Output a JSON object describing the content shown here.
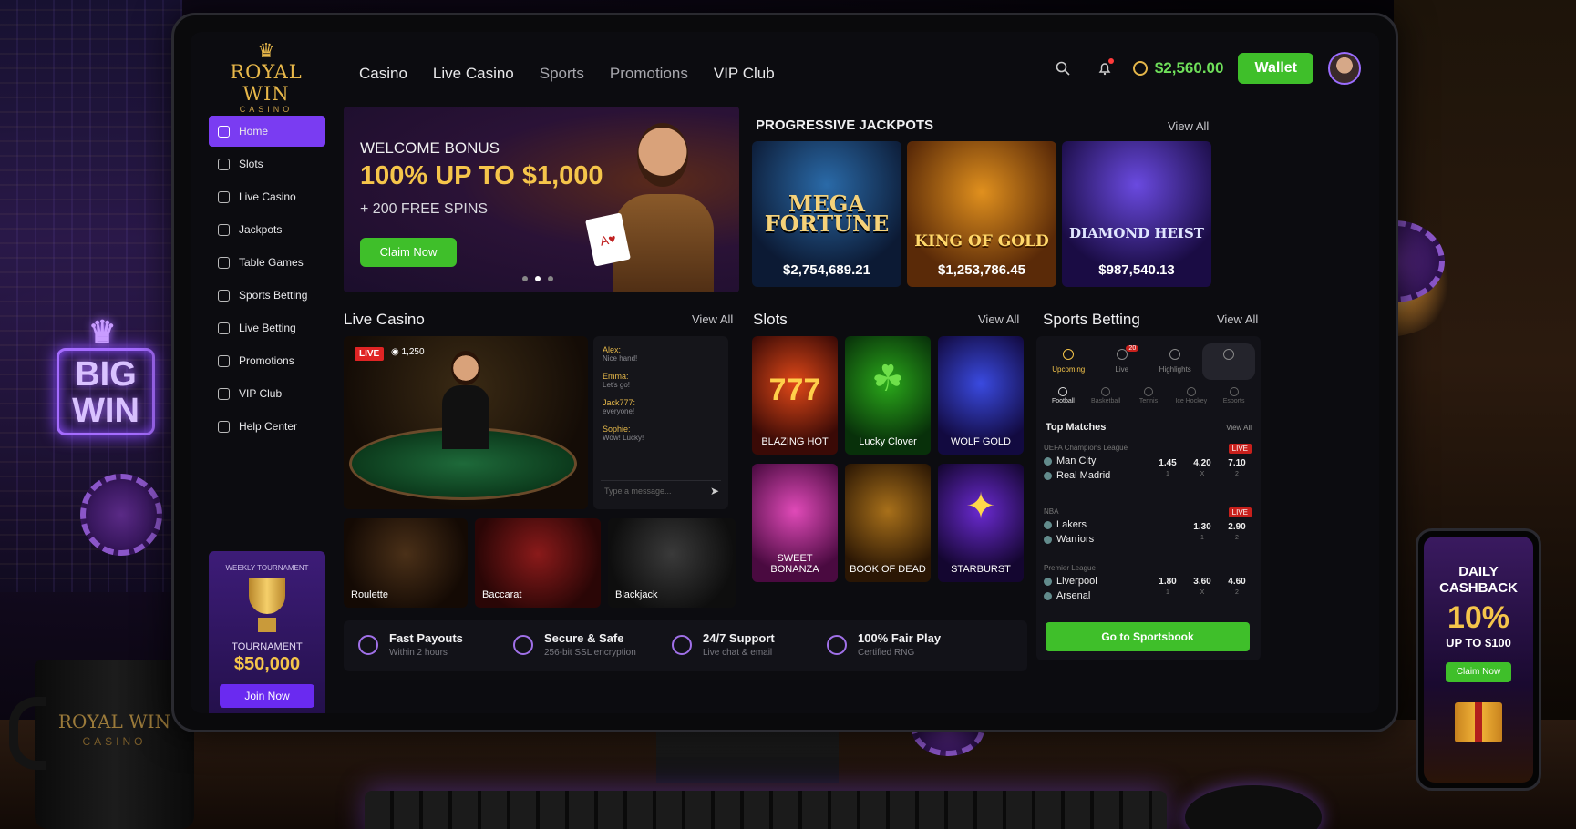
{
  "brand": {
    "name": "ROYAL WIN",
    "sub": "CASINO"
  },
  "nav": [
    "Casino",
    "Live Casino",
    "Sports",
    "Promotions",
    "VIP Club"
  ],
  "header": {
    "balance": "$2,560.00",
    "wallet": "Wallet"
  },
  "sidebar": {
    "items": [
      "Home",
      "Slots",
      "Live Casino",
      "Jackpots",
      "Table Games",
      "Sports Betting",
      "Live Betting",
      "Promotions",
      "VIP Club",
      "Help Center"
    ]
  },
  "tournament": {
    "top": "WEEKLY TOURNAMENT",
    "label": "TOURNAMENT",
    "amount": "$50,000",
    "button": "Join Now"
  },
  "hero": {
    "line1": "WELCOME BONUS",
    "line2": "100% UP TO $1,000",
    "line3": "+ 200 FREE SPINS",
    "button": "Claim Now"
  },
  "jackpots": {
    "title": "PROGRESSIVE JACKPOTS",
    "view_all": "View All",
    "items": [
      {
        "name": "MEGA FORTUNE",
        "amount": "$2,754,689.21"
      },
      {
        "name": "KING OF GOLD",
        "amount": "$1,253,786.45"
      },
      {
        "name": "DIAMOND HEIST",
        "amount": "$987,540.13"
      }
    ]
  },
  "live_casino": {
    "title": "Live Casino",
    "view_all": "View All",
    "badge": "LIVE",
    "viewers": "1,250",
    "tables": [
      "Roulette",
      "Baccarat",
      "Blackjack"
    ],
    "chat": [
      {
        "name": "Alex:",
        "msg": "Nice hand!"
      },
      {
        "name": "Emma:",
        "msg": "Let's go!"
      },
      {
        "name": "Jack777:",
        "msg": "everyone!"
      },
      {
        "name": "Sophie:",
        "msg": "Wow! Lucky!"
      }
    ],
    "chat_placeholder": "Type a message..."
  },
  "slots": {
    "title": "Slots",
    "view_all": "View All",
    "items": [
      "BLAZING HOT",
      "Lucky Clover",
      "WOLF GOLD",
      "SWEET BONANZA",
      "BOOK OF DEAD",
      "STARBURST"
    ]
  },
  "sports": {
    "title": "Sports Betting",
    "view_all": "View All",
    "tabs": [
      "Upcoming",
      "Live",
      "Highlights"
    ],
    "live_count": "20",
    "cats": [
      "Football",
      "Basketball",
      "Tennis",
      "Ice Hockey",
      "Esports"
    ],
    "top": "Top Matches",
    "top_view": "View All",
    "matches": [
      {
        "league": "UEFA Champions League",
        "t1": "Man City",
        "t2": "Real Madrid",
        "odds": [
          [
            "1.45",
            "1"
          ],
          [
            "4.20",
            "X"
          ],
          [
            "7.10",
            "2"
          ]
        ],
        "live": "LIVE"
      },
      {
        "league": "NBA",
        "t1": "Lakers",
        "t2": "Warriors",
        "odds": [
          [
            "1.30",
            "1"
          ],
          [
            "2.90",
            "2"
          ]
        ],
        "live": "LIVE"
      },
      {
        "league": "Premier League",
        "t1": "Liverpool",
        "t2": "Arsenal",
        "odds": [
          [
            "1.80",
            "1"
          ],
          [
            "3.60",
            "X"
          ],
          [
            "4.60",
            "2"
          ]
        ],
        "live": ""
      }
    ],
    "button": "Go to Sportsbook"
  },
  "features": [
    {
      "t": "Fast Payouts",
      "s": "Within 2 hours"
    },
    {
      "t": "Secure & Safe",
      "s": "256-bit SSL encryption"
    },
    {
      "t": "24/7 Support",
      "s": "Live chat & email"
    },
    {
      "t": "100% Fair Play",
      "s": "Certified RNG"
    }
  ],
  "decor": {
    "bigwin": [
      "BIG",
      "WIN"
    ],
    "mug": "ROYAL WIN",
    "mug_sub": "CASINO"
  },
  "phone": {
    "a": "DAILY",
    "b": "CASHBACK",
    "pct": "10%",
    "c": "UP TO $100",
    "btn": "Claim Now"
  }
}
